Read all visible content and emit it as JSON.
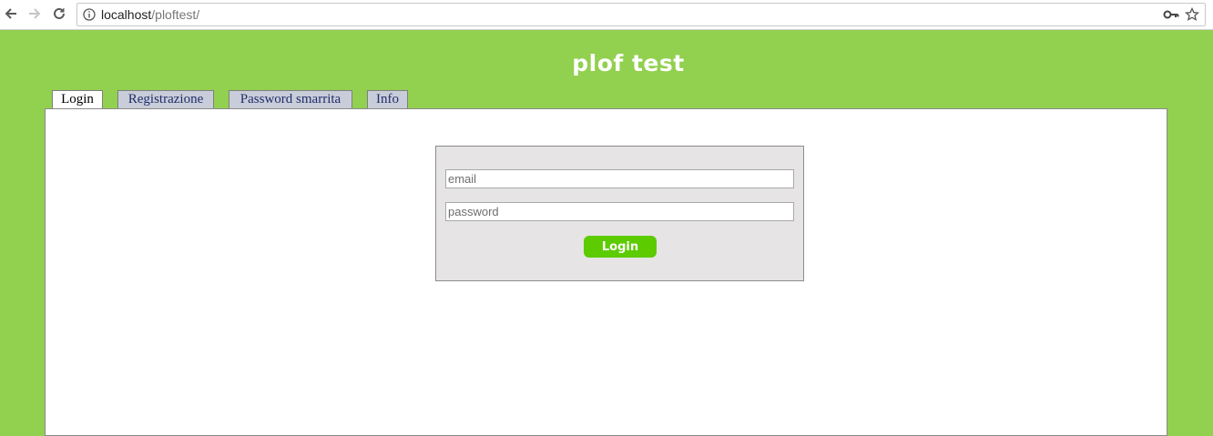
{
  "browser": {
    "url_host": "localhost",
    "url_path": "/ploftest/"
  },
  "page": {
    "title": "plof test",
    "tabs": [
      {
        "label": "Login",
        "active": true
      },
      {
        "label": "Registrazione",
        "active": false
      },
      {
        "label": "Password smarrita",
        "active": false
      },
      {
        "label": "Info",
        "active": false
      }
    ]
  },
  "login_form": {
    "email_placeholder": "email",
    "password_placeholder": "password",
    "submit_label": "Login"
  },
  "colors": {
    "page_background": "#92d050",
    "button": "#5ccb00",
    "form_background": "#e6e4e5"
  }
}
